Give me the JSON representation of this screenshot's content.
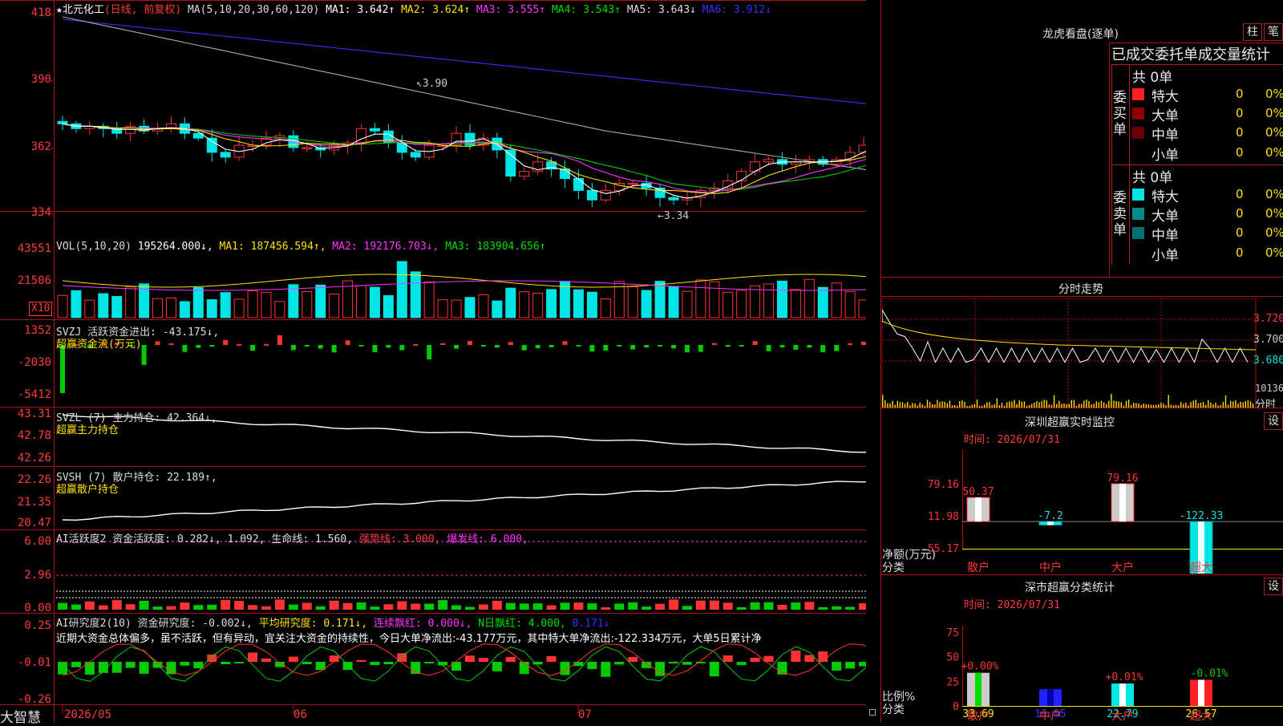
{
  "app": {
    "name": "大智慧"
  },
  "main_chart": {
    "stock_name": "北元化工",
    "mode": "(日线, 前复权)",
    "ma_label": "MA(5,10,20,30,60,120)",
    "ma1": "MA1: 3.642↑",
    "ma2": "MA2: 3.624↑",
    "ma3": "MA3: 3.555↑",
    "ma4": "MA4: 3.543↑",
    "ma5": "MA5: 3.643↓",
    "ma6": "MA6: 3.912↓",
    "y_ticks": [
      "418",
      "390",
      "362",
      "334"
    ],
    "high_note": "3.90",
    "low_note": "3.34"
  },
  "vol": {
    "label": "VOL(5,10,20)",
    "value": "195264.000↓,",
    "ma1": "MA1: 187456.594↑,",
    "ma2": "MA2: 192176.703↓,",
    "ma3": "MA3: 183904.656↑",
    "y_ticks": [
      "43551",
      "21506"
    ],
    "unit": "X10"
  },
  "svzj": {
    "label": "SVZJ  活跃资金进出: -43.175↓,",
    "sub": "超赢资金流(万元)",
    "y_ticks": [
      "1352",
      "-2030",
      "-5412"
    ]
  },
  "svzl": {
    "label": "SVZL (7) 主力持仓: 42.364↓,",
    "sub": "超赢主力持仓",
    "y_ticks": [
      "43.31",
      "42.78",
      "42.26"
    ]
  },
  "svsh": {
    "label": "SVSH (7) 散户持仓: 22.189↑,",
    "sub": "超赢散户持仓",
    "y_ticks": [
      "22.26",
      "21.35",
      "20.47"
    ]
  },
  "ai_active": {
    "label": "AI活跃度2 资金活跃度: 0.282↓, 1.092, 生命线: 1.560,",
    "strong": "强势线: 3.000,",
    "burst": "爆发线: 6.000,",
    "y_ticks": [
      "6.00",
      "2.96",
      "0.00"
    ]
  },
  "ai_research": {
    "label": "AI研究度2(10) 资金研究度: -0.002↓,",
    "avg": "平均研究度: 0.171↓,",
    "cont": "连续飘红: 0.000↓,",
    "nday": "N日飘红: 4.000,",
    "v171": "0.171↓",
    "comment": "近期大资金总体偏多，虽不活跃，但有异动，宜关注大资金的持续性，今日大单净流出:-43.177万元，其中特大单净流出:-122.334万元，大单5日累计净",
    "y_ticks": [
      "0.25",
      "-0.01",
      "-0.26"
    ]
  },
  "x_axis": {
    "labels": [
      "2026/05",
      "06",
      "07"
    ]
  },
  "longhu": {
    "title": "龙虎看盘(逐单)",
    "tab_zhu": "柱",
    "tab_bi": "笔",
    "header": "已成交委托单成交量统计",
    "buy_label": "委买单",
    "sell_label": "委卖单",
    "buy_total": "共 0单",
    "sell_total": "共 0单",
    "rows": [
      {
        "name": "特大",
        "count": "0",
        "pct": "0%"
      },
      {
        "name": "大单",
        "count": "0",
        "pct": "0%"
      },
      {
        "name": "中单",
        "count": "0",
        "pct": "0%"
      },
      {
        "name": "小单",
        "count": "0",
        "pct": "0%"
      }
    ]
  },
  "intraday": {
    "title": "分时走势",
    "prices": [
      "3.720",
      "3.700",
      "3.680"
    ],
    "vol": "10136",
    "unit": "分时"
  },
  "sz_monitor": {
    "title": "深圳超赢实时监控",
    "set": "设",
    "time": "时间: 2026/07/31",
    "y_ticks": [
      "79.16",
      "11.98",
      "-55.17",
      "-122.33"
    ],
    "unit_line1": "净额(万元)",
    "unit_line2": "分类",
    "categories": [
      "散户",
      "中户",
      "大户",
      "超大"
    ],
    "values": [
      50.37,
      -7.2,
      79.16,
      -122.33
    ],
    "value_labels": [
      "50.37",
      "-7.2",
      "79.16",
      "-122.33"
    ]
  },
  "sz_class": {
    "title": "深市超赢分类统计",
    "set": "设",
    "time": "时间: 2026/07/31",
    "y_ticks": [
      "75",
      "50",
      "25",
      "0"
    ],
    "unit_line1": "比例%",
    "unit_line2": "分类",
    "categories": [
      "散户",
      "中户",
      "大户",
      "超大"
    ],
    "values": [
      33.69,
      16.95,
      22.79,
      26.57
    ],
    "changes": [
      "+0.00%",
      "",
      "+0.01%",
      "-0.01%"
    ]
  },
  "colors": {
    "up": "#ff3333",
    "down": "#00e5e5",
    "grid": "#b01010",
    "yellow": "#ffe000",
    "magenta": "#ff33ff",
    "green": "#00cc00",
    "blue": "#3333ff"
  }
}
